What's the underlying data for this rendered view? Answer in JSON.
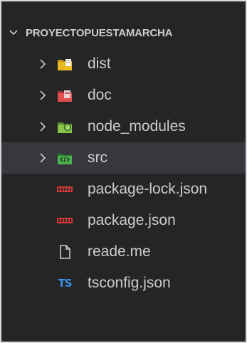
{
  "explorer": {
    "section_title": "PROYECTOPUESTAMARCHA",
    "section_icon": "chevron-down-icon",
    "items": [
      {
        "label": "dist",
        "kind": "folder",
        "icon": "folder-dist-icon",
        "color": "#e8b923"
      },
      {
        "label": "doc",
        "kind": "folder",
        "icon": "folder-doc-icon",
        "color": "#e04f4f"
      },
      {
        "label": "node_modules",
        "kind": "folder",
        "icon": "folder-node-modules-icon",
        "color": "#8bc34a"
      },
      {
        "label": "src",
        "kind": "folder",
        "icon": "folder-src-icon",
        "color": "#4caf50",
        "selected": true
      },
      {
        "label": "package-lock.json",
        "kind": "file",
        "icon": "npm-icon",
        "color": "#cb3837"
      },
      {
        "label": "package.json",
        "kind": "file",
        "icon": "npm-icon",
        "color": "#cb3837"
      },
      {
        "label": "reade.me",
        "kind": "file",
        "icon": "document-icon",
        "color": "#cccccc"
      },
      {
        "label": "tsconfig.json",
        "kind": "file",
        "icon": "tsconfig-icon",
        "color": "#3b8eea"
      }
    ]
  },
  "icons": {
    "tsconfig_glyph": "TS"
  },
  "colors": {
    "background": "#252526",
    "selected_row": "#37373d",
    "text": "#cccccc",
    "frame": "#d9d9d9"
  }
}
